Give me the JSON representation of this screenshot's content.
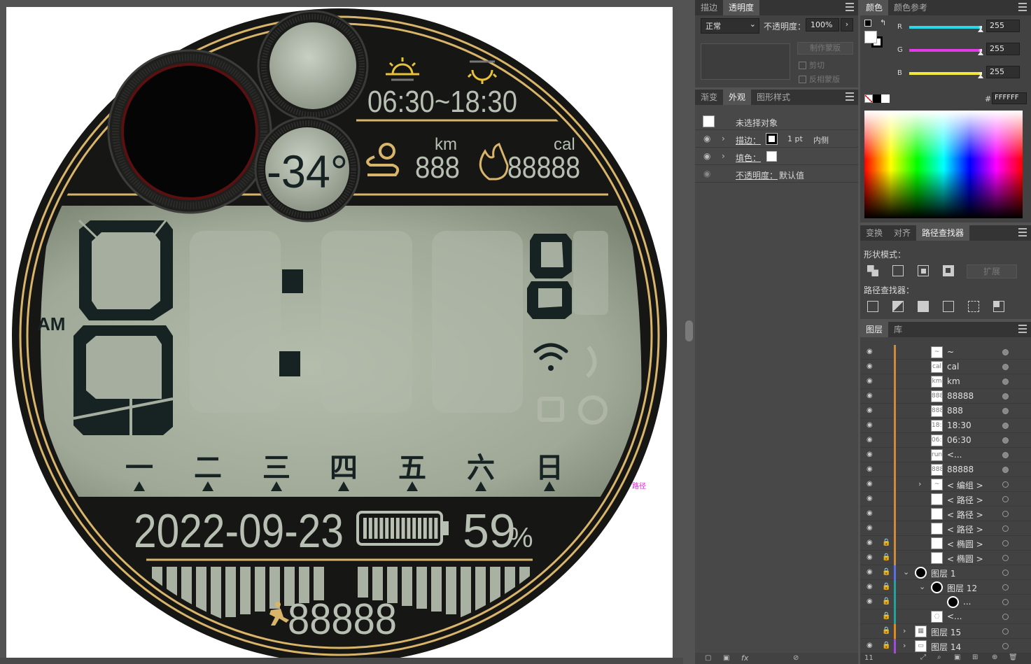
{
  "watch": {
    "temperature": "-34°",
    "sunrise_sunset": "06:30~18:30",
    "distance_unit": "km",
    "distance_value": "888",
    "calorie_unit": "cal",
    "calorie_value": "88888",
    "am_label": "AM",
    "hour_digit": "8",
    "second_digit": "8",
    "weekdays": [
      "一",
      "二",
      "三",
      "四",
      "五",
      "六",
      "日"
    ],
    "date": "2022-09-23",
    "battery_percent": "59",
    "percent_sign": "%",
    "steps": "88888",
    "battery_level": 0.59,
    "path_tag": "路径"
  },
  "colors": {
    "bezel": "#161614",
    "gold": "#d8b56a",
    "lcd": "#a6ae9f",
    "lcd_dark": "#8c9485",
    "ink": "#172222",
    "silver": "#b9c1b4",
    "magenta": "#e020e0"
  },
  "transparency_panel": {
    "tabs": [
      "描边",
      "透明度"
    ],
    "blend_mode": "正常",
    "opacity_label": "不透明度：",
    "opacity_value": "100%",
    "make_mask": "制作蒙版",
    "clip": "剪切",
    "invert_mask": "反相蒙版"
  },
  "appearance_panel": {
    "tabs": [
      "渐变",
      "外观",
      "图形样式"
    ],
    "no_selection": "未选择对象",
    "stroke_label": "描边：",
    "stroke_value": "1 pt",
    "stroke_align": "内侧",
    "fill_label": "填色：",
    "opacity_label": "不透明度：",
    "opacity_value": "默认值"
  },
  "color_panel": {
    "tabs": [
      "颜色",
      "颜色参考"
    ],
    "channels": [
      {
        "name": "R",
        "value": "255",
        "color": "#27d8e8"
      },
      {
        "name": "G",
        "value": "255",
        "color": "#e13be8"
      },
      {
        "name": "B",
        "value": "255",
        "color": "#f0e83a"
      }
    ],
    "hex_label": "#",
    "hex_value": "FFFFFF"
  },
  "pathfinder_panel": {
    "tabs": [
      "变换",
      "对齐",
      "路径查找器"
    ],
    "shape_modes": "形状模式：",
    "expand": "扩展",
    "pathfinders": "路径查找器："
  },
  "layers_panel": {
    "tabs": [
      "图层",
      "库"
    ],
    "rows": [
      {
        "name": "~",
        "thumb": "~"
      },
      {
        "name": "cal",
        "thumb": "cal"
      },
      {
        "name": "km",
        "thumb": "km"
      },
      {
        "name": "88888",
        "thumb": "8888"
      },
      {
        "name": "888",
        "thumb": "888"
      },
      {
        "name": "18:30",
        "thumb": "18:30"
      },
      {
        "name": "06:30",
        "thumb": "06:30"
      },
      {
        "name": "<...",
        "thumb": "run"
      },
      {
        "name": "88888",
        "thumb": "8888"
      },
      {
        "name": "< 编组 >",
        "thumb": "~"
      },
      {
        "name": "< 路径 >",
        "thumb": ""
      },
      {
        "name": "< 路径 >",
        "thumb": ""
      },
      {
        "name": "< 路径 >",
        "thumb": ""
      },
      {
        "name": "< 椭圆 >",
        "thumb": ""
      },
      {
        "name": "< 椭圆 >",
        "thumb": ""
      },
      {
        "name": "图层 1",
        "thumb": "●"
      },
      {
        "name": "图层 12",
        "thumb": "●"
      },
      {
        "name": "...",
        "thumb": "●"
      },
      {
        "name": "<...",
        "thumb": "◌"
      },
      {
        "name": "图层 15",
        "thumb": "▦"
      },
      {
        "name": "图层 14",
        "thumb": "▭"
      }
    ],
    "footer_count": "11"
  }
}
